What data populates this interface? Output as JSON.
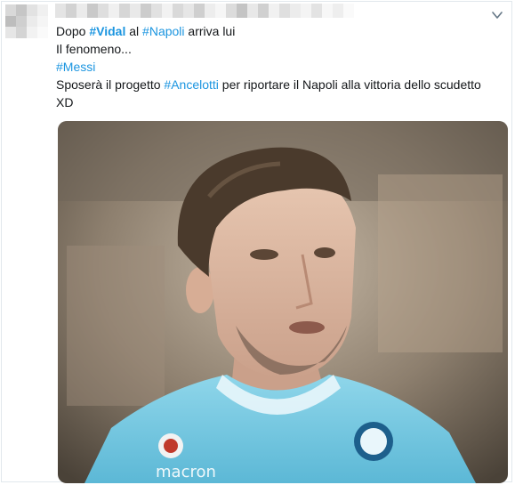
{
  "tweet": {
    "line1": {
      "pre": "Dopo ",
      "tag1": "#Vidal",
      "mid": " al ",
      "tag2": "#Napoli",
      "post": " arriva lui"
    },
    "line2": "Il fenomeno...",
    "line3_tag": "#Messi",
    "line4": {
      "pre": "Sposerà il progetto ",
      "tag": "#Ancelotti",
      "post": " per riportare il Napoli alla vittoria dello scudetto"
    },
    "line5": "XD"
  },
  "icons": {
    "menu": "chevron-down-icon",
    "avatar": "avatar",
    "media": "player-photo"
  },
  "colors": {
    "hashtag": "#1b95e0",
    "text": "#14171a",
    "border": "#e1e8ed"
  }
}
